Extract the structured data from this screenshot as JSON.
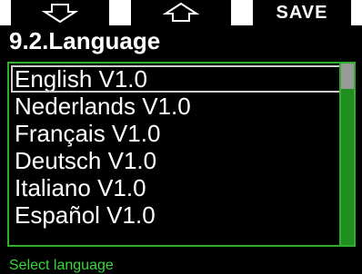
{
  "softkeys": {
    "down_icon": "arrow-down-outline-icon",
    "up_icon": "arrow-up-outline-icon",
    "save_label": "SAVE"
  },
  "header": {
    "title": "9.2.Language"
  },
  "languages": [
    {
      "label": "English V1.0",
      "selected": true
    },
    {
      "label": "Nederlands V1.0",
      "selected": false
    },
    {
      "label": "Français V1.0",
      "selected": false
    },
    {
      "label": "Deutsch V1.0",
      "selected": false
    },
    {
      "label": "Italiano V1.0",
      "selected": false
    },
    {
      "label": "Español V1.0",
      "selected": false
    }
  ],
  "status": {
    "hint": "Select language"
  },
  "colors": {
    "accent_green": "#2fae2f",
    "status_green": "#37d837",
    "background": "#000000",
    "softkey_bar": "#ffffff"
  }
}
